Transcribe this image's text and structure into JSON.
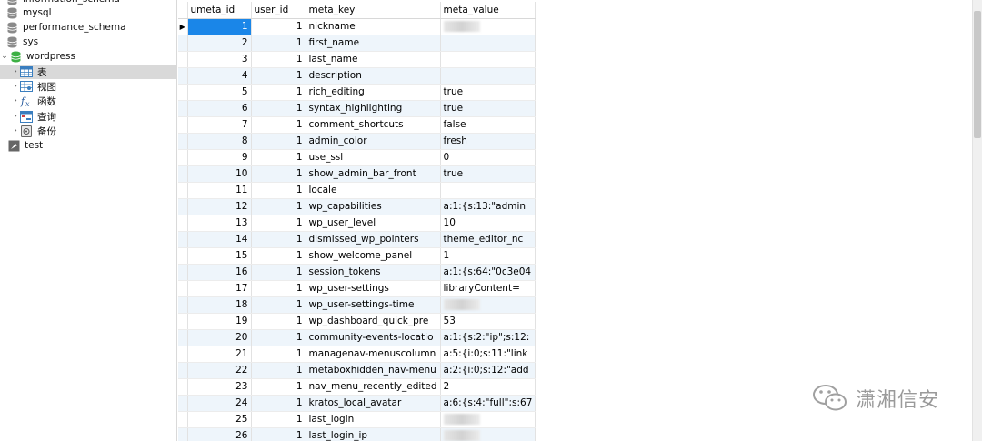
{
  "sidebar": {
    "items": [
      {
        "label": "information_schema",
        "type": "db"
      },
      {
        "label": "mysql",
        "type": "db"
      },
      {
        "label": "performance_schema",
        "type": "db"
      },
      {
        "label": "sys",
        "type": "db"
      },
      {
        "label": "wordpress",
        "type": "db-open"
      },
      {
        "label": "表",
        "type": "tables"
      },
      {
        "label": "视图",
        "type": "views"
      },
      {
        "label": "函数",
        "type": "functions"
      },
      {
        "label": "查询",
        "type": "queries"
      },
      {
        "label": "备份",
        "type": "backups"
      },
      {
        "label": "test",
        "type": "connection"
      }
    ]
  },
  "grid": {
    "columns": [
      "umeta_id",
      "user_id",
      "meta_key",
      "meta_value"
    ],
    "rows": [
      [
        "1",
        "1",
        "nickname",
        ""
      ],
      [
        "2",
        "1",
        "first_name",
        ""
      ],
      [
        "3",
        "1",
        "last_name",
        ""
      ],
      [
        "4",
        "1",
        "description",
        ""
      ],
      [
        "5",
        "1",
        "rich_editing",
        "true"
      ],
      [
        "6",
        "1",
        "syntax_highlighting",
        "true"
      ],
      [
        "7",
        "1",
        "comment_shortcuts",
        "false"
      ],
      [
        "8",
        "1",
        "admin_color",
        "fresh"
      ],
      [
        "9",
        "1",
        "use_ssl",
        "0"
      ],
      [
        "10",
        "1",
        "show_admin_bar_front",
        "true"
      ],
      [
        "11",
        "1",
        "locale",
        ""
      ],
      [
        "12",
        "1",
        "wp_capabilities",
        "a:1:{s:13:\"admin"
      ],
      [
        "13",
        "1",
        "wp_user_level",
        "10"
      ],
      [
        "14",
        "1",
        "dismissed_wp_pointers",
        "theme_editor_nc"
      ],
      [
        "15",
        "1",
        "show_welcome_panel",
        "1"
      ],
      [
        "16",
        "1",
        "session_tokens",
        "a:1:{s:64:\"0c3e04"
      ],
      [
        "17",
        "1",
        "wp_user-settings",
        "libraryContent="
      ],
      [
        "18",
        "1",
        "wp_user-settings-time",
        ""
      ],
      [
        "19",
        "1",
        "wp_dashboard_quick_pre",
        "53"
      ],
      [
        "20",
        "1",
        "community-events-locatio",
        "a:1:{s:2:\"ip\";s:12:"
      ],
      [
        "21",
        "1",
        "managenav-menuscolumn",
        "a:5:{i:0;s:11:\"link"
      ],
      [
        "22",
        "1",
        "metaboxhidden_nav-menu",
        "a:2:{i:0;s:12:\"add"
      ],
      [
        "23",
        "1",
        "nav_menu_recently_edited",
        "2"
      ],
      [
        "24",
        "1",
        "kratos_local_avatar",
        "a:6:{s:4:\"full\";s:67"
      ],
      [
        "25",
        "1",
        "last_login",
        ""
      ],
      [
        "26",
        "1",
        "last_login_ip",
        ""
      ]
    ],
    "blurred_rows": [
      0,
      17,
      24,
      25
    ],
    "current_row_indicator": "▶"
  },
  "watermark": {
    "text": "潇湘信安"
  },
  "colors": {
    "selection": "#1a86e8",
    "alt_row": "#eef5fb",
    "db_icon": "#8a8a8a",
    "db_open_icon": "#3cb043"
  }
}
